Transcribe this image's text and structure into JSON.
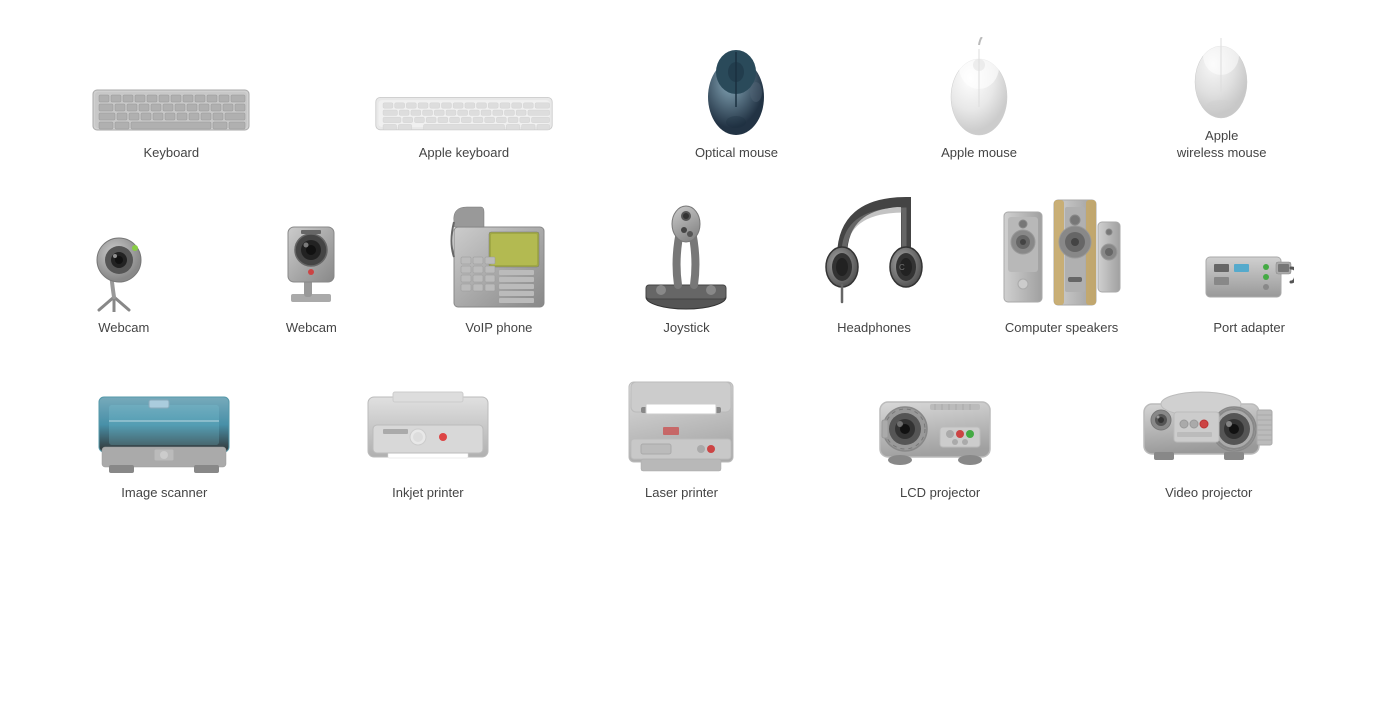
{
  "rows": [
    {
      "id": "row1",
      "items": [
        {
          "id": "keyboard",
          "label": "Keyboard"
        },
        {
          "id": "apple-keyboard",
          "label": "Apple keyboard"
        },
        {
          "id": "optical-mouse",
          "label": "Optical mouse"
        },
        {
          "id": "apple-mouse",
          "label": "Apple mouse"
        },
        {
          "id": "apple-wireless-mouse",
          "label": "Apple\nwireless mouse"
        }
      ]
    },
    {
      "id": "row2",
      "items": [
        {
          "id": "webcam1",
          "label": "Webcam"
        },
        {
          "id": "webcam2",
          "label": "Webcam"
        },
        {
          "id": "voip-phone",
          "label": "VoIP phone"
        },
        {
          "id": "joystick",
          "label": "Joystick"
        },
        {
          "id": "headphones",
          "label": "Headphones"
        },
        {
          "id": "computer-speakers",
          "label": "Computer speakers"
        },
        {
          "id": "port-adapter",
          "label": "Port adapter"
        }
      ]
    },
    {
      "id": "row3",
      "items": [
        {
          "id": "image-scanner",
          "label": "Image scanner"
        },
        {
          "id": "inkjet-printer",
          "label": "Inkjet printer"
        },
        {
          "id": "laser-printer",
          "label": "Laser printer"
        },
        {
          "id": "lcd-projector",
          "label": "LCD projector"
        },
        {
          "id": "video-projector",
          "label": "Video projector"
        }
      ]
    }
  ]
}
